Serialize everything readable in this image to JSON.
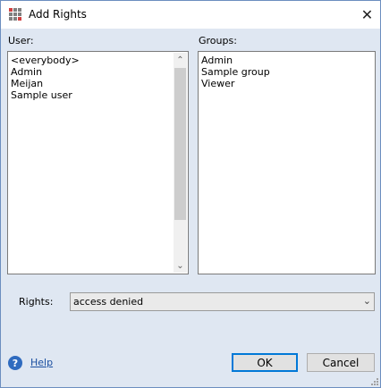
{
  "window": {
    "title": "Add Rights",
    "app_icon": "grid-app-icon",
    "close_icon": "close-icon",
    "close_glyph": "✕"
  },
  "users": {
    "label": "User:",
    "items": [
      "<everybody>",
      "Admin",
      "Meijan",
      "Sample user"
    ],
    "scroll_up_glyph": "⌃",
    "scroll_down_glyph": "⌄"
  },
  "groups": {
    "label": "Groups:",
    "items": [
      "Admin",
      "Sample group",
      "Viewer"
    ]
  },
  "rights": {
    "label": "Rights:",
    "selected": "access denied",
    "dropdown_glyph": "⌄"
  },
  "footer": {
    "help_label": "Help",
    "help_icon_glyph": "?",
    "ok_label": "OK",
    "cancel_label": "Cancel"
  },
  "colors": {
    "background": "#dfe7f2",
    "window_border": "#6c8ebf",
    "link": "#1a4fa0",
    "help_icon": "#2f6bbf",
    "ok_focus_border": "#0078d7",
    "app_icon_colors": [
      "#d04040",
      "#808080",
      "#808080",
      "#808080",
      "#808080",
      "#808080",
      "#808080",
      "#808080",
      "#d04040"
    ]
  }
}
